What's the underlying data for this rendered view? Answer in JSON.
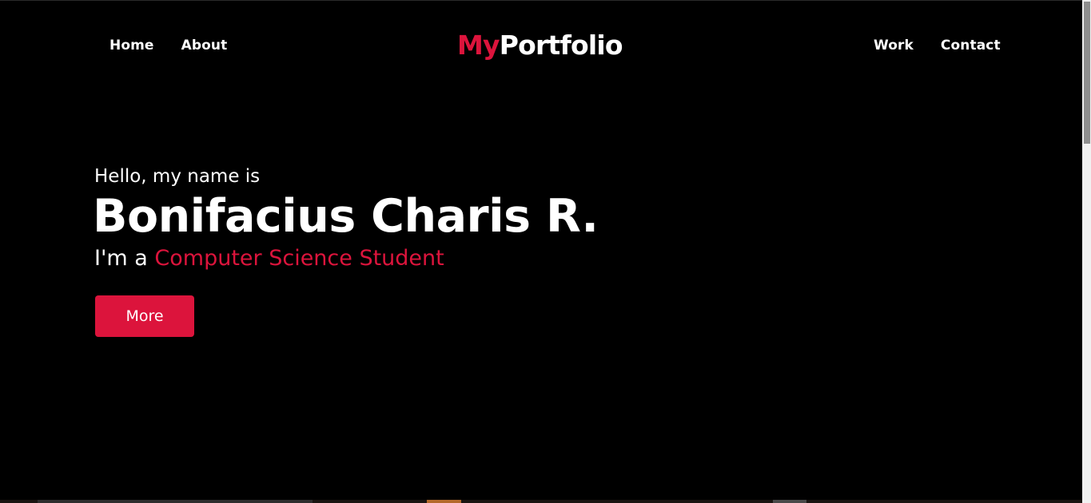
{
  "nav": {
    "left": [
      {
        "label": "Home"
      },
      {
        "label": "About"
      }
    ],
    "right": [
      {
        "label": "Work"
      },
      {
        "label": "Contact"
      }
    ],
    "logo": {
      "accent": "My",
      "rest": "Portfolio"
    }
  },
  "hero": {
    "greeting": "Hello, my name is",
    "name": "Bonifacius Charis R.",
    "role_prefix": "I'm a ",
    "role": "Computer Science Student",
    "button_label": "More"
  },
  "colors": {
    "accent": "#dc143c",
    "background": "#000000",
    "text": "#ffffff"
  }
}
